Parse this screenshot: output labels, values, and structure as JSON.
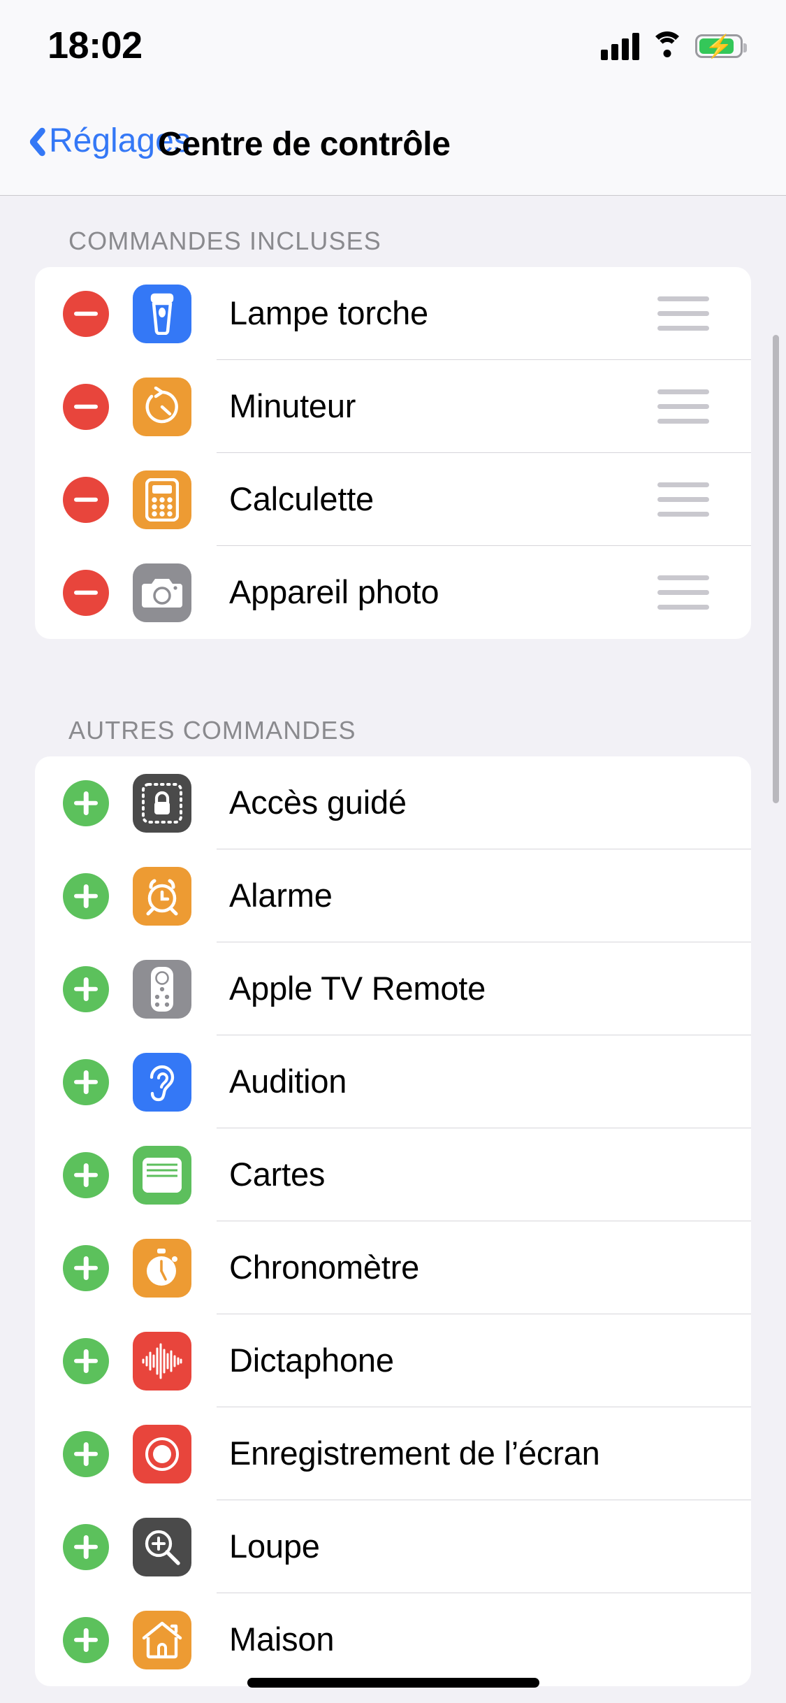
{
  "status_bar": {
    "time": "18:02",
    "signal_icon": "cellular-bars-icon",
    "wifi_icon": "wifi-icon",
    "battery_icon": "battery-charging-icon",
    "battery_charging": true
  },
  "nav": {
    "back_label": "Réglages",
    "back_icon": "chevron-left-icon",
    "title": "Centre de contrôle"
  },
  "colors": {
    "accent_blue": "#3478f6",
    "remove_red": "#e8453c",
    "add_green": "#5cc15c",
    "orange": "#ed9b33",
    "blue": "#3478f6",
    "gray": "#8e8e93",
    "dark_gray": "#4a4a4a",
    "green": "#5dbf5d",
    "red": "#e8453c",
    "page_bg": "#f2f1f6",
    "card_bg": "#ffffff"
  },
  "sections": [
    {
      "header": "COMMANDES INCLUSES",
      "mode": "included",
      "rows": [
        {
          "label": "Lampe torche",
          "icon": "flashlight-icon",
          "icon_color": "#3478f6",
          "action": "remove",
          "handle": true
        },
        {
          "label": "Minuteur",
          "icon": "timer-icon",
          "icon_color": "#ed9b33",
          "action": "remove",
          "handle": true
        },
        {
          "label": "Calculette",
          "icon": "calculator-icon",
          "icon_color": "#ed9b33",
          "action": "remove",
          "handle": true
        },
        {
          "label": "Appareil photo",
          "icon": "camera-icon",
          "icon_color": "#8e8e93",
          "action": "remove",
          "handle": true
        }
      ]
    },
    {
      "header": "AUTRES COMMANDES",
      "mode": "other",
      "rows": [
        {
          "label": "Accès guidé",
          "icon": "guided-access-lock-icon",
          "icon_color": "#4a4a4a",
          "action": "add",
          "handle": false
        },
        {
          "label": "Alarme",
          "icon": "alarm-clock-icon",
          "icon_color": "#ed9b33",
          "action": "add",
          "handle": false
        },
        {
          "label": "Apple TV Remote",
          "icon": "tv-remote-icon",
          "icon_color": "#8e8e93",
          "action": "add",
          "handle": false
        },
        {
          "label": "Audition",
          "icon": "ear-hearing-icon",
          "icon_color": "#3478f6",
          "action": "add",
          "handle": false
        },
        {
          "label": "Cartes",
          "icon": "wallet-icon",
          "icon_color": "#5dbf5d",
          "action": "add",
          "handle": false
        },
        {
          "label": "Chronomètre",
          "icon": "stopwatch-icon",
          "icon_color": "#ed9b33",
          "action": "add",
          "handle": false
        },
        {
          "label": "Dictaphone",
          "icon": "voice-memos-waveform-icon",
          "icon_color": "#e8453c",
          "action": "add",
          "handle": false
        },
        {
          "label": "Enregistrement de l’écran",
          "icon": "screen-record-icon",
          "icon_color": "#e8453c",
          "action": "add",
          "handle": false
        },
        {
          "label": "Loupe",
          "icon": "magnifier-icon",
          "icon_color": "#4a4a4a",
          "action": "add",
          "handle": false
        },
        {
          "label": "Maison",
          "icon": "home-house-icon",
          "icon_color": "#ed9b33",
          "action": "add",
          "handle": false
        }
      ]
    }
  ],
  "home_indicator": "home-indicator"
}
